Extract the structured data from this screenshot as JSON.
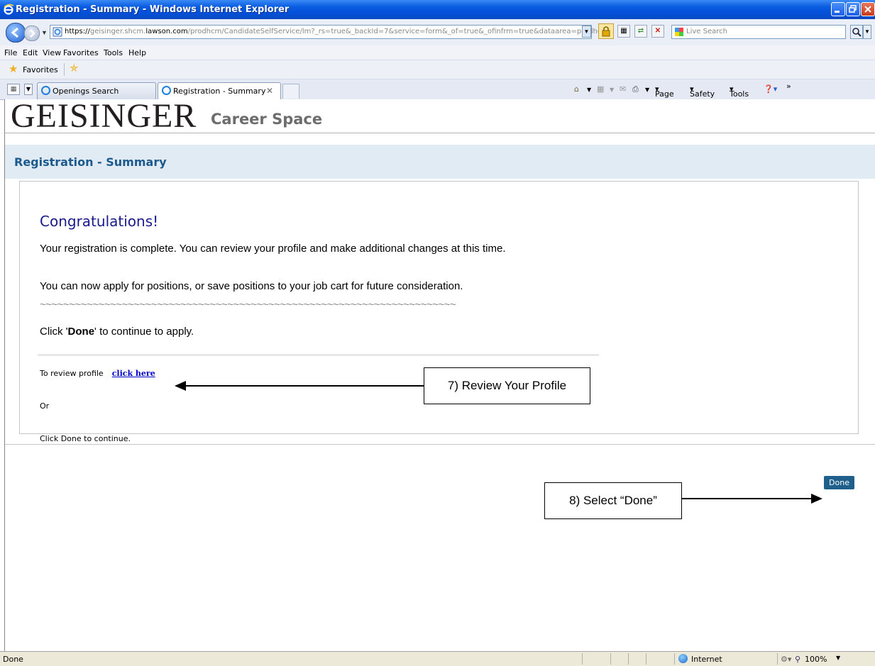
{
  "window": {
    "title": "Registration - Summary - Windows Internet Explorer"
  },
  "address": {
    "url_prefix": "https://",
    "url_domain_pre": "geisinger.shcm.",
    "url_domain": "lawson.com",
    "url_path": "/prodhcm/CandidateSelfService/lm?_rs=true&_backId=7&service=form&_of=true&_ofinfrm=true&dataarea=prodhcm",
    "search_placeholder": "Live Search"
  },
  "menu": [
    "File",
    "Edit",
    "View",
    "Favorites",
    "Tools",
    "Help"
  ],
  "favorites": {
    "label": "Favorites"
  },
  "tabs": [
    {
      "label": "Openings Search"
    },
    {
      "label": "Registration - Summary"
    }
  ],
  "command_bar": {
    "page": "Page",
    "safety": "Safety",
    "tools": "Tools"
  },
  "site": {
    "brand": "GEISINGER",
    "subbrand": "Career Space"
  },
  "page": {
    "header": "Registration - Summary",
    "congrats": "Congratulations!",
    "para1": "Your registration is complete. You can review your profile and make additional changes at this time.",
    "para2": "You can now apply for positions, or save positions to your job cart for future consideration.",
    "tildes": "~~~~~~~~~~~~~~~~~~~~~~~~~~~~~~~~~~~~~~~~~~~~~~~~~~~~~~~~~~~~~~~~~~~~~~~",
    "click_done_pre": "Click '",
    "click_done_bold": "Done",
    "click_done_post": "' to continue to apply.",
    "review_label": "To review profile",
    "review_link": "click here",
    "or": "Or",
    "click_done_continue": "Click Done to continue.",
    "done_button": "Done"
  },
  "annotations": {
    "review": "7) Review Your Profile",
    "done": "8) Select “Done”"
  },
  "status": {
    "text": "Done",
    "zone": "Internet",
    "zoom": "100%"
  }
}
